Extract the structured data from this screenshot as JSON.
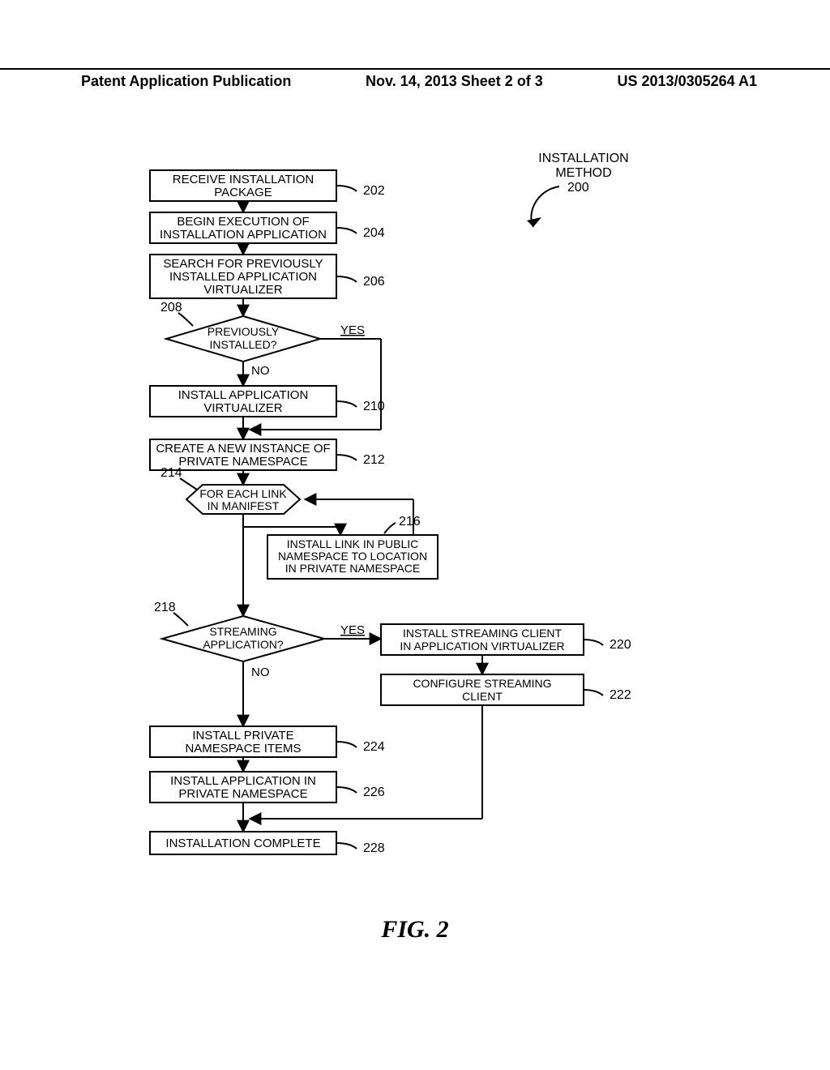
{
  "header": {
    "left": "Patent Application Publication",
    "center": "Nov. 14, 2013  Sheet 2 of 3",
    "right": "US 2013/0305264 A1"
  },
  "figure_caption": "FIG. 2",
  "title_block": {
    "line1": "INSTALLATION",
    "line2": "METHOD",
    "ref": "200"
  },
  "steps": {
    "s202": {
      "ref": "202",
      "l1": "RECEIVE INSTALLATION",
      "l2": "PACKAGE"
    },
    "s204": {
      "ref": "204",
      "l1": "BEGIN EXECUTION OF",
      "l2": "INSTALLATION APPLICATION"
    },
    "s206": {
      "ref": "206",
      "l1": "SEARCH FOR PREVIOUSLY",
      "l2": "INSTALLED APPLICATION",
      "l3": "VIRTUALIZER"
    },
    "d208": {
      "ref": "208",
      "l1": "PREVIOUSLY",
      "l2": "INSTALLED?",
      "yes": "YES",
      "no": "NO"
    },
    "s210": {
      "ref": "210",
      "l1": "INSTALL APPLICATION",
      "l2": "VIRTUALIZER"
    },
    "s212": {
      "ref": "212",
      "l1": "CREATE A NEW INSTANCE OF",
      "l2": "PRIVATE NAMESPACE"
    },
    "loop214": {
      "ref": "214",
      "l1": "FOR EACH LINK",
      "l2": "IN MANIFEST"
    },
    "s216": {
      "ref": "216",
      "l1": "INSTALL LINK IN PUBLIC",
      "l2": "NAMESPACE TO LOCATION",
      "l3": "IN PRIVATE NAMESPACE"
    },
    "d218": {
      "ref": "218",
      "l1": "STREAMING",
      "l2": "APPLICATION?",
      "yes": "YES",
      "no": "NO"
    },
    "s220": {
      "ref": "220",
      "l1": "INSTALL STREAMING CLIENT",
      "l2": "IN APPLICATION VIRTUALIZER"
    },
    "s222": {
      "ref": "222",
      "l1": "CONFIGURE STREAMING",
      "l2": "CLIENT"
    },
    "s224": {
      "ref": "224",
      "l1": "INSTALL PRIVATE",
      "l2": "NAMESPACE ITEMS"
    },
    "s226": {
      "ref": "226",
      "l1": "INSTALL APPLICATION IN",
      "l2": "PRIVATE NAMESPACE"
    },
    "s228": {
      "ref": "228",
      "l1": "INSTALLATION COMPLETE"
    }
  }
}
